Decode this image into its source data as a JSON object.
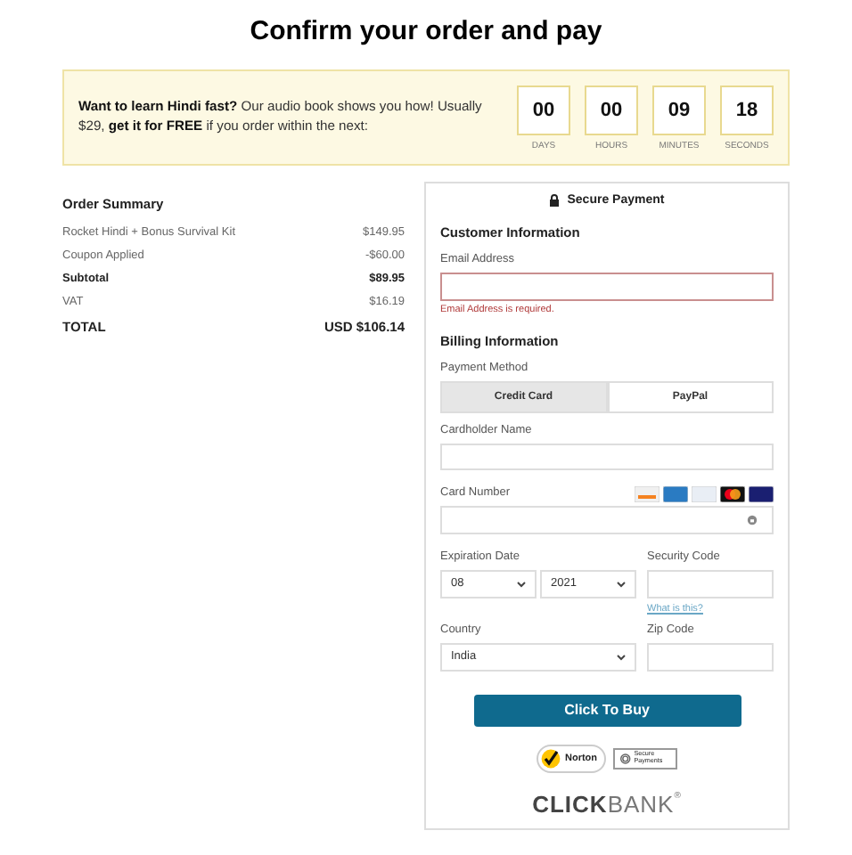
{
  "title": "Confirm your order and pay",
  "promo": {
    "text": "**Want to learn Hindi fast?** Our audio book shows you how! Usually $29, **get it for FREE** if you order within the next:",
    "countdown": [
      {
        "value": "00",
        "unit": "DAYS"
      },
      {
        "value": "00",
        "unit": "HOURS"
      },
      {
        "value": "09",
        "unit": "MINUTES"
      },
      {
        "value": "18",
        "unit": "SECONDS"
      }
    ]
  },
  "order_summary": {
    "title": "Order Summary",
    "rows": [
      {
        "label": "Rocket Hindi + Bonus Survival Kit",
        "amount": "$149.95",
        "kind": "line"
      },
      {
        "label": "Coupon Applied",
        "amount": "-$60.00",
        "kind": "line"
      },
      {
        "label": "Subtotal",
        "amount": "$89.95",
        "kind": "subtotal"
      },
      {
        "label": "VAT",
        "amount": "$16.19",
        "kind": "line"
      },
      {
        "label": "TOTAL",
        "amount": "USD $106.14",
        "kind": "total"
      }
    ]
  },
  "payment": {
    "title": "Secure Payment",
    "customer_heading": "Customer Information",
    "email": {
      "label": "Email Address",
      "error": "Email Address is required."
    },
    "billing_heading": "Billing Information",
    "method_label": "Payment Method",
    "methods": [
      {
        "label": "Credit Card",
        "selected": true
      },
      {
        "label": "PayPal",
        "selected": false
      }
    ],
    "cardholder_label": "Cardholder Name",
    "card_number_label": "Card Number",
    "expiration_label": "Expiration Date",
    "month": "08",
    "year": "2021",
    "security_label": "Security Code",
    "security_help": "What is this?",
    "country_label": "Country",
    "country": "India",
    "zip_label": "Zip Code",
    "buy_button": "Click To Buy",
    "norton": "Norton",
    "secure_badge": "Secure Payments",
    "brand_bold": "CLICK",
    "brand_light": "BANK",
    "brand_mark": "®"
  }
}
